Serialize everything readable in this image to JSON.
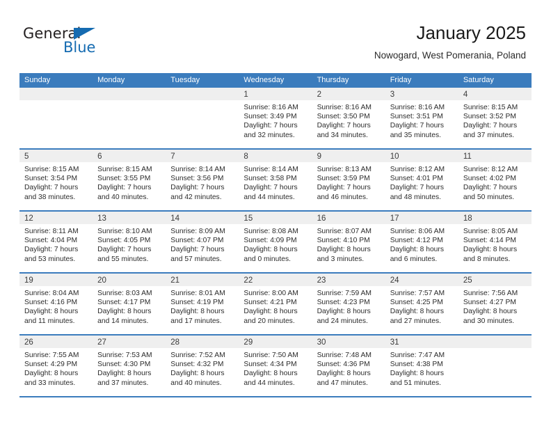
{
  "brand": {
    "name_part1": "General",
    "name_part2": "Blue",
    "accent_color": "#156bb1"
  },
  "header": {
    "title": "January 2025",
    "subtitle": "Nowogard, West Pomerania, Poland"
  },
  "calendar": {
    "header_color": "#3b7cbd",
    "weekdays": [
      "Sunday",
      "Monday",
      "Tuesday",
      "Wednesday",
      "Thursday",
      "Friday",
      "Saturday"
    ],
    "weeks": [
      [
        {
          "day": "",
          "lines": []
        },
        {
          "day": "",
          "lines": []
        },
        {
          "day": "",
          "lines": []
        },
        {
          "day": "1",
          "lines": [
            "Sunrise: 8:16 AM",
            "Sunset: 3:49 PM",
            "Daylight: 7 hours",
            "and 32 minutes."
          ]
        },
        {
          "day": "2",
          "lines": [
            "Sunrise: 8:16 AM",
            "Sunset: 3:50 PM",
            "Daylight: 7 hours",
            "and 34 minutes."
          ]
        },
        {
          "day": "3",
          "lines": [
            "Sunrise: 8:16 AM",
            "Sunset: 3:51 PM",
            "Daylight: 7 hours",
            "and 35 minutes."
          ]
        },
        {
          "day": "4",
          "lines": [
            "Sunrise: 8:15 AM",
            "Sunset: 3:52 PM",
            "Daylight: 7 hours",
            "and 37 minutes."
          ]
        }
      ],
      [
        {
          "day": "5",
          "lines": [
            "Sunrise: 8:15 AM",
            "Sunset: 3:54 PM",
            "Daylight: 7 hours",
            "and 38 minutes."
          ]
        },
        {
          "day": "6",
          "lines": [
            "Sunrise: 8:15 AM",
            "Sunset: 3:55 PM",
            "Daylight: 7 hours",
            "and 40 minutes."
          ]
        },
        {
          "day": "7",
          "lines": [
            "Sunrise: 8:14 AM",
            "Sunset: 3:56 PM",
            "Daylight: 7 hours",
            "and 42 minutes."
          ]
        },
        {
          "day": "8",
          "lines": [
            "Sunrise: 8:14 AM",
            "Sunset: 3:58 PM",
            "Daylight: 7 hours",
            "and 44 minutes."
          ]
        },
        {
          "day": "9",
          "lines": [
            "Sunrise: 8:13 AM",
            "Sunset: 3:59 PM",
            "Daylight: 7 hours",
            "and 46 minutes."
          ]
        },
        {
          "day": "10",
          "lines": [
            "Sunrise: 8:12 AM",
            "Sunset: 4:01 PM",
            "Daylight: 7 hours",
            "and 48 minutes."
          ]
        },
        {
          "day": "11",
          "lines": [
            "Sunrise: 8:12 AM",
            "Sunset: 4:02 PM",
            "Daylight: 7 hours",
            "and 50 minutes."
          ]
        }
      ],
      [
        {
          "day": "12",
          "lines": [
            "Sunrise: 8:11 AM",
            "Sunset: 4:04 PM",
            "Daylight: 7 hours",
            "and 53 minutes."
          ]
        },
        {
          "day": "13",
          "lines": [
            "Sunrise: 8:10 AM",
            "Sunset: 4:05 PM",
            "Daylight: 7 hours",
            "and 55 minutes."
          ]
        },
        {
          "day": "14",
          "lines": [
            "Sunrise: 8:09 AM",
            "Sunset: 4:07 PM",
            "Daylight: 7 hours",
            "and 57 minutes."
          ]
        },
        {
          "day": "15",
          "lines": [
            "Sunrise: 8:08 AM",
            "Sunset: 4:09 PM",
            "Daylight: 8 hours",
            "and 0 minutes."
          ]
        },
        {
          "day": "16",
          "lines": [
            "Sunrise: 8:07 AM",
            "Sunset: 4:10 PM",
            "Daylight: 8 hours",
            "and 3 minutes."
          ]
        },
        {
          "day": "17",
          "lines": [
            "Sunrise: 8:06 AM",
            "Sunset: 4:12 PM",
            "Daylight: 8 hours",
            "and 6 minutes."
          ]
        },
        {
          "day": "18",
          "lines": [
            "Sunrise: 8:05 AM",
            "Sunset: 4:14 PM",
            "Daylight: 8 hours",
            "and 8 minutes."
          ]
        }
      ],
      [
        {
          "day": "19",
          "lines": [
            "Sunrise: 8:04 AM",
            "Sunset: 4:16 PM",
            "Daylight: 8 hours",
            "and 11 minutes."
          ]
        },
        {
          "day": "20",
          "lines": [
            "Sunrise: 8:03 AM",
            "Sunset: 4:17 PM",
            "Daylight: 8 hours",
            "and 14 minutes."
          ]
        },
        {
          "day": "21",
          "lines": [
            "Sunrise: 8:01 AM",
            "Sunset: 4:19 PM",
            "Daylight: 8 hours",
            "and 17 minutes."
          ]
        },
        {
          "day": "22",
          "lines": [
            "Sunrise: 8:00 AM",
            "Sunset: 4:21 PM",
            "Daylight: 8 hours",
            "and 20 minutes."
          ]
        },
        {
          "day": "23",
          "lines": [
            "Sunrise: 7:59 AM",
            "Sunset: 4:23 PM",
            "Daylight: 8 hours",
            "and 24 minutes."
          ]
        },
        {
          "day": "24",
          "lines": [
            "Sunrise: 7:57 AM",
            "Sunset: 4:25 PM",
            "Daylight: 8 hours",
            "and 27 minutes."
          ]
        },
        {
          "day": "25",
          "lines": [
            "Sunrise: 7:56 AM",
            "Sunset: 4:27 PM",
            "Daylight: 8 hours",
            "and 30 minutes."
          ]
        }
      ],
      [
        {
          "day": "26",
          "lines": [
            "Sunrise: 7:55 AM",
            "Sunset: 4:29 PM",
            "Daylight: 8 hours",
            "and 33 minutes."
          ]
        },
        {
          "day": "27",
          "lines": [
            "Sunrise: 7:53 AM",
            "Sunset: 4:30 PM",
            "Daylight: 8 hours",
            "and 37 minutes."
          ]
        },
        {
          "day": "28",
          "lines": [
            "Sunrise: 7:52 AM",
            "Sunset: 4:32 PM",
            "Daylight: 8 hours",
            "and 40 minutes."
          ]
        },
        {
          "day": "29",
          "lines": [
            "Sunrise: 7:50 AM",
            "Sunset: 4:34 PM",
            "Daylight: 8 hours",
            "and 44 minutes."
          ]
        },
        {
          "day": "30",
          "lines": [
            "Sunrise: 7:48 AM",
            "Sunset: 4:36 PM",
            "Daylight: 8 hours",
            "and 47 minutes."
          ]
        },
        {
          "day": "31",
          "lines": [
            "Sunrise: 7:47 AM",
            "Sunset: 4:38 PM",
            "Daylight: 8 hours",
            "and 51 minutes."
          ]
        },
        {
          "day": "",
          "lines": []
        }
      ]
    ]
  }
}
